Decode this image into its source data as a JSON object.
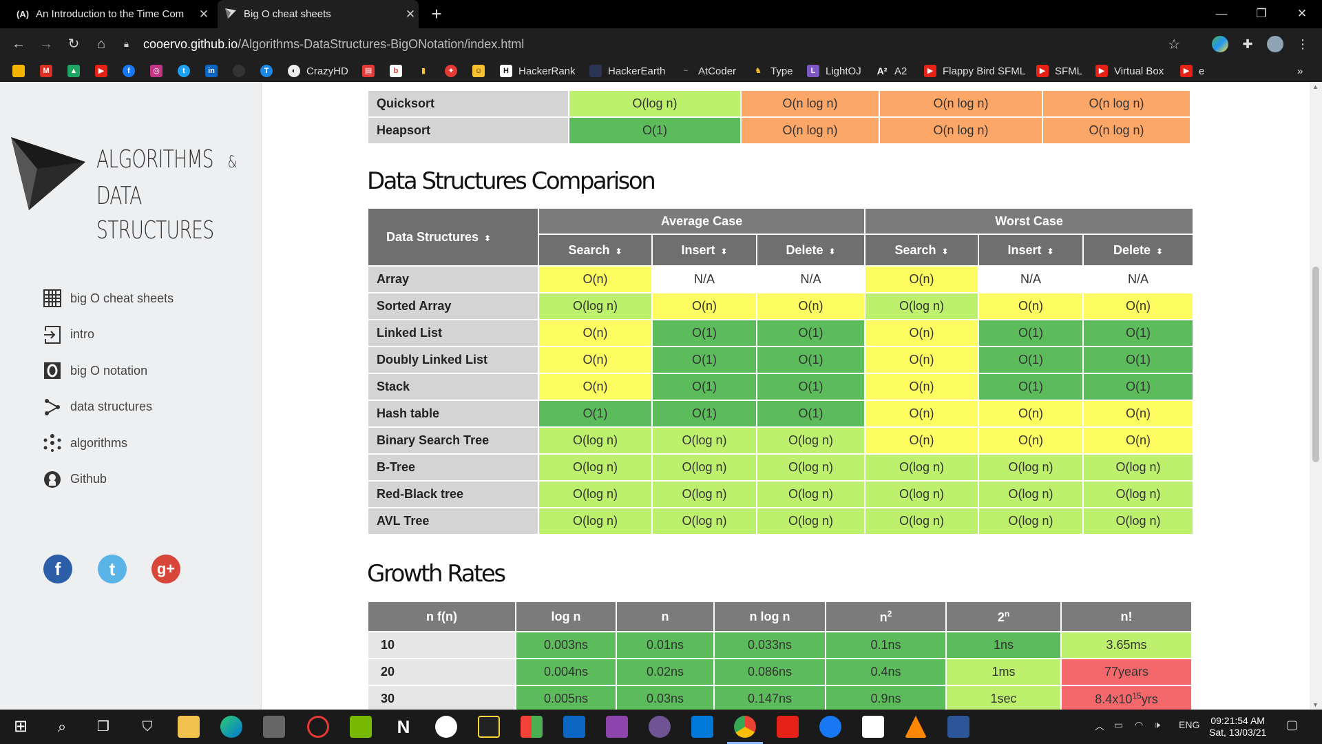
{
  "browser": {
    "tabs": [
      {
        "favicon": "(A)",
        "title": "An Introduction to the Time Com"
      },
      {
        "title": "Big O cheat sheets"
      }
    ],
    "url_host": "cooervo.github.io",
    "url_path": "/Algorithms-DataStructures-BigONotation/index.html",
    "bookmarks": [
      {
        "label": "CrazyHD",
        "icon": "crazyhd-icon"
      },
      {
        "label": "HackerRank",
        "icon": "hackerrank-icon"
      },
      {
        "label": "HackerEarth",
        "icon": "hackerearth-icon"
      },
      {
        "label": "AtCoder",
        "icon": "atcoder-icon"
      },
      {
        "label": "Type",
        "icon": "type-icon"
      },
      {
        "label": "LightOJ",
        "icon": "lightoj-icon"
      },
      {
        "label": "A2",
        "icon": "a2-icon"
      },
      {
        "label": "Flappy Bird SFML",
        "icon": "youtube-icon"
      },
      {
        "label": "SFML",
        "icon": "youtube-icon"
      },
      {
        "label": "Virtual Box",
        "icon": "youtube-icon"
      },
      {
        "label": "e",
        "icon": "youtube-icon"
      }
    ],
    "more_bookmarks": "»"
  },
  "sidebar": {
    "logo_line1": "ALGORITHMS",
    "logo_amp": "&",
    "logo_line2": "DATA STRUCTURES",
    "nav": [
      {
        "label": "big O cheat sheets",
        "icon": "grid-icon"
      },
      {
        "label": "intro",
        "icon": "login-icon"
      },
      {
        "label": "big O notation",
        "icon": "o-icon"
      },
      {
        "label": "data structures",
        "icon": "share-icon"
      },
      {
        "label": "algorithms",
        "icon": "dots-icon"
      },
      {
        "label": "Github",
        "icon": "github-icon"
      }
    ],
    "social": [
      {
        "glyph": "f",
        "icon": "facebook-icon",
        "color": "#2d5fa8"
      },
      {
        "glyph": "t",
        "icon": "twitter-icon",
        "color": "#5ab4e8"
      },
      {
        "glyph": "g+",
        "icon": "google-plus-icon",
        "color": "#d8463a"
      }
    ]
  },
  "sort_rows": [
    {
      "name": "Quicksort",
      "cells": [
        [
          "O(log n)",
          "lg"
        ],
        [
          "O(n log n)",
          "or"
        ],
        [
          "O(n log n)",
          "or"
        ],
        [
          "O(n log n)",
          "or"
        ]
      ]
    },
    {
      "name": "Heapsort",
      "cells": [
        [
          "O(1)",
          "dg"
        ],
        [
          "O(n log n)",
          "or"
        ],
        [
          "O(n log n)",
          "or"
        ],
        [
          "O(n log n)",
          "or"
        ]
      ]
    }
  ],
  "ds": {
    "heading": "Data Structures Comparison",
    "col_label": "Data Structures",
    "avg_label": "Average Case",
    "worst_label": "Worst Case",
    "ops": [
      "Search",
      "Insert",
      "Delete",
      "Search",
      "Insert",
      "Delete"
    ],
    "rows": [
      {
        "name": "Array",
        "cells": [
          [
            "O(n)",
            "ye"
          ],
          [
            "N/A",
            "wh"
          ],
          [
            "N/A",
            "wh"
          ],
          [
            "O(n)",
            "ye"
          ],
          [
            "N/A",
            "wh"
          ],
          [
            "N/A",
            "wh"
          ]
        ]
      },
      {
        "name": "Sorted Array",
        "cells": [
          [
            "O(log n)",
            "lg"
          ],
          [
            "O(n)",
            "ye"
          ],
          [
            "O(n)",
            "ye"
          ],
          [
            "O(log n)",
            "lg"
          ],
          [
            "O(n)",
            "ye"
          ],
          [
            "O(n)",
            "ye"
          ]
        ]
      },
      {
        "name": "Linked List",
        "cells": [
          [
            "O(n)",
            "ye"
          ],
          [
            "O(1)",
            "dg"
          ],
          [
            "O(1)",
            "dg"
          ],
          [
            "O(n)",
            "ye"
          ],
          [
            "O(1)",
            "dg"
          ],
          [
            "O(1)",
            "dg"
          ]
        ]
      },
      {
        "name": "Doubly Linked List",
        "cells": [
          [
            "O(n)",
            "ye"
          ],
          [
            "O(1)",
            "dg"
          ],
          [
            "O(1)",
            "dg"
          ],
          [
            "O(n)",
            "ye"
          ],
          [
            "O(1)",
            "dg"
          ],
          [
            "O(1)",
            "dg"
          ]
        ]
      },
      {
        "name": "Stack",
        "cells": [
          [
            "O(n)",
            "ye"
          ],
          [
            "O(1)",
            "dg"
          ],
          [
            "O(1)",
            "dg"
          ],
          [
            "O(n)",
            "ye"
          ],
          [
            "O(1)",
            "dg"
          ],
          [
            "O(1)",
            "dg"
          ]
        ]
      },
      {
        "name": "Hash table",
        "cells": [
          [
            "O(1)",
            "dg"
          ],
          [
            "O(1)",
            "dg"
          ],
          [
            "O(1)",
            "dg"
          ],
          [
            "O(n)",
            "ye"
          ],
          [
            "O(n)",
            "ye"
          ],
          [
            "O(n)",
            "ye"
          ]
        ]
      },
      {
        "name": "Binary Search Tree",
        "cells": [
          [
            "O(log n)",
            "lg"
          ],
          [
            "O(log n)",
            "lg"
          ],
          [
            "O(log n)",
            "lg"
          ],
          [
            "O(n)",
            "ye"
          ],
          [
            "O(n)",
            "ye"
          ],
          [
            "O(n)",
            "ye"
          ]
        ]
      },
      {
        "name": "B-Tree",
        "cells": [
          [
            "O(log n)",
            "lg"
          ],
          [
            "O(log n)",
            "lg"
          ],
          [
            "O(log n)",
            "lg"
          ],
          [
            "O(log n)",
            "lg"
          ],
          [
            "O(log n)",
            "lg"
          ],
          [
            "O(log n)",
            "lg"
          ]
        ]
      },
      {
        "name": "Red-Black tree",
        "cells": [
          [
            "O(log n)",
            "lg"
          ],
          [
            "O(log n)",
            "lg"
          ],
          [
            "O(log n)",
            "lg"
          ],
          [
            "O(log n)",
            "lg"
          ],
          [
            "O(log n)",
            "lg"
          ],
          [
            "O(log n)",
            "lg"
          ]
        ]
      },
      {
        "name": "AVL Tree",
        "cells": [
          [
            "O(log n)",
            "lg"
          ],
          [
            "O(log n)",
            "lg"
          ],
          [
            "O(log n)",
            "lg"
          ],
          [
            "O(log n)",
            "lg"
          ],
          [
            "O(log n)",
            "lg"
          ],
          [
            "O(log n)",
            "lg"
          ]
        ]
      }
    ]
  },
  "growth": {
    "heading": "Growth Rates",
    "headers": [
      "n f(n)",
      "log n",
      "n",
      "n log n",
      "n2",
      "2n",
      "n!"
    ],
    "header_base": [
      "n f(n)",
      "log n",
      "n",
      "n log n",
      "n",
      "2",
      "n!"
    ],
    "header_sup": [
      "",
      "",
      "",
      "",
      "2",
      "n",
      ""
    ],
    "rows": [
      {
        "n": "10",
        "cells": [
          [
            "0.003ns",
            "dg"
          ],
          [
            "0.01ns",
            "dg"
          ],
          [
            "0.033ns",
            "dg"
          ],
          [
            "0.1ns",
            "dg"
          ],
          [
            "1ns",
            "dg"
          ],
          [
            "3.65ms",
            "lg"
          ]
        ]
      },
      {
        "n": "20",
        "cells": [
          [
            "0.004ns",
            "dg"
          ],
          [
            "0.02ns",
            "dg"
          ],
          [
            "0.086ns",
            "dg"
          ],
          [
            "0.4ns",
            "dg"
          ],
          [
            "1ms",
            "lg"
          ],
          [
            "77years",
            "rd"
          ]
        ]
      },
      {
        "n": "30",
        "cells": [
          [
            "0.005ns",
            "dg"
          ],
          [
            "0.03ns",
            "dg"
          ],
          [
            "0.147ns",
            "dg"
          ],
          [
            "0.9ns",
            "dg"
          ],
          [
            "1sec",
            "lg"
          ],
          [
            "8.4x1015yrs",
            "rd"
          ]
        ]
      }
    ],
    "last_cell_base": "8.4x10",
    "last_cell_sup": "15",
    "last_cell_tail": "yrs"
  },
  "taskbar": {
    "language": "ENG",
    "time": "09:21:54 AM",
    "date": "Sat, 13/03/21"
  },
  "colors": {
    "light_green": "#bdf06c",
    "dark_green": "#5cbc5c",
    "yellow": "#fdfd62",
    "orange": "#fca668",
    "red": "#f4676b",
    "header_gray": "#7b7b7b"
  }
}
